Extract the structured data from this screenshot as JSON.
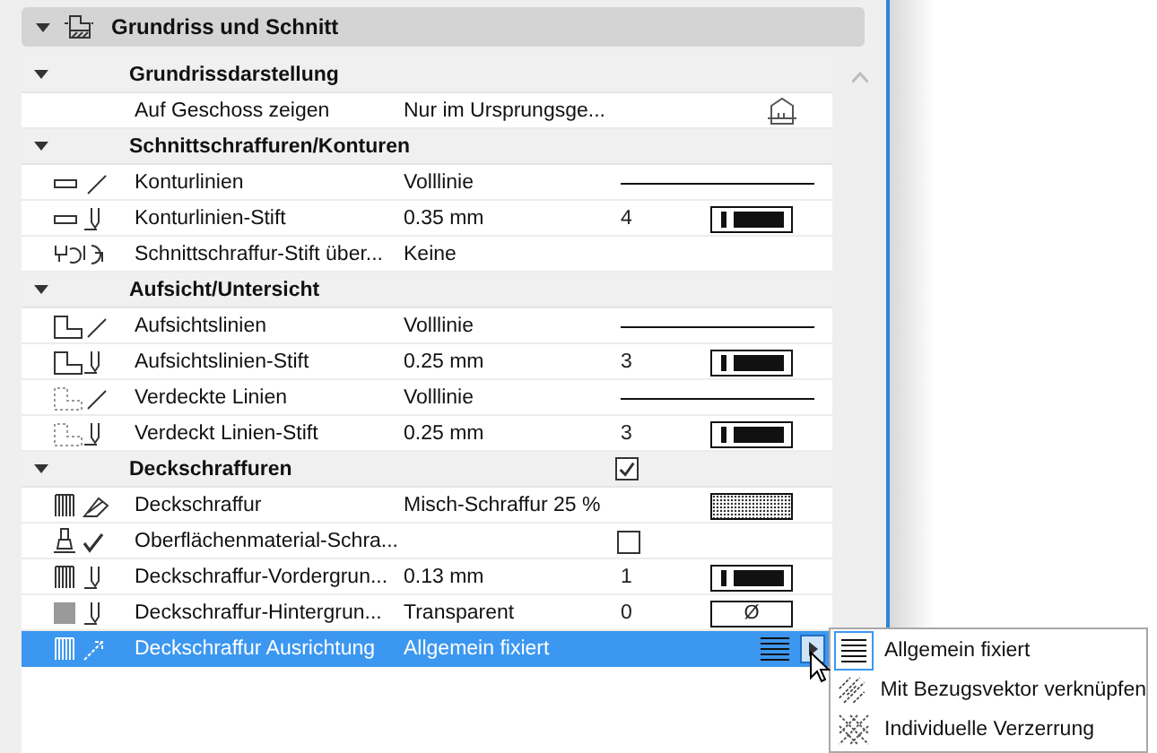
{
  "panel": {
    "title": "Grundriss und Schnitt",
    "expanded": true,
    "sections": [
      {
        "label": "Grundrissdarstellung",
        "expanded": true,
        "rows": [
          {
            "label": "Auf Geschoss zeigen",
            "value": "Nur im Ursprungsge...",
            "kind": "story",
            "selected": false
          }
        ]
      },
      {
        "label": "Schnittschraffuren/Konturen",
        "expanded": true,
        "rows": [
          {
            "label": "Konturlinien",
            "value": "Volllinie",
            "kind": "line",
            "selected": false
          },
          {
            "label": "Konturlinien-Stift",
            "value": "0.35 mm",
            "pen": "4",
            "kind": "pen",
            "selected": false
          },
          {
            "label": "Schnittschraffur-Stift über...",
            "value": "Keine",
            "kind": "plain",
            "selected": false
          }
        ]
      },
      {
        "label": "Aufsicht/Untersicht",
        "expanded": true,
        "rows": [
          {
            "label": "Aufsichtslinien",
            "value": "Volllinie",
            "kind": "line",
            "selected": false
          },
          {
            "label": "Aufsichtslinien-Stift",
            "value": "0.25 mm",
            "pen": "3",
            "kind": "pen",
            "selected": false
          },
          {
            "label": "Verdeckte Linien",
            "value": "Volllinie",
            "kind": "line",
            "selected": false
          },
          {
            "label": "Verdeckt Linien-Stift",
            "value": "0.25 mm",
            "pen": "3",
            "kind": "pen",
            "selected": false
          }
        ]
      },
      {
        "label": "Deckschraffuren",
        "expanded": true,
        "checked": true,
        "rows": [
          {
            "label": "Deckschraffur",
            "value": "Misch-Schraffur 25 %",
            "kind": "pattern",
            "selected": false
          },
          {
            "label": "Oberflächenmaterial-Schra...",
            "checked": false,
            "kind": "checkbox",
            "selected": false
          },
          {
            "label": "Deckschraffur-Vordergrun...",
            "value": "0.13 mm",
            "pen": "1",
            "kind": "pen",
            "selected": false
          },
          {
            "label": "Deckschraffur-Hintergrun...",
            "value": "Transparent",
            "pen": "0",
            "kind": "pen_empty",
            "swatch_text": "Ø",
            "selected": false
          },
          {
            "label": "Deckschraffur Ausrichtung",
            "value": "Allgemein fixiert",
            "kind": "orientation",
            "selected": true
          }
        ]
      }
    ]
  },
  "menu": [
    {
      "label": "Allgemein fixiert",
      "selected": true
    },
    {
      "label": "Mit Bezugsvektor verknüpfen",
      "selected": false
    },
    {
      "label": "Individuelle Verzerrung",
      "selected": false
    }
  ]
}
